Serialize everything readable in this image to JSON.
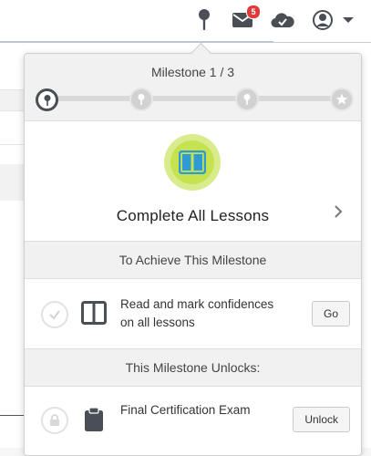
{
  "topbar": {
    "notifications_count": "5"
  },
  "milestone": {
    "title": "Milestone 1 / 3",
    "current": 1,
    "total": 3
  },
  "hero": {
    "title": "Complete All Lessons"
  },
  "achieve": {
    "heading": "To Achieve This Milestone",
    "task_text": "Read and mark confidences on all lessons",
    "task_button": "Go"
  },
  "unlocks": {
    "heading": "This Milestone Unlocks:",
    "item_text": "Final Certification Exam",
    "item_button": "Unlock"
  },
  "colors": {
    "badge": "#e03b3b",
    "book_circle": "#c6e34f",
    "book_icon": "#2f9bd6"
  }
}
